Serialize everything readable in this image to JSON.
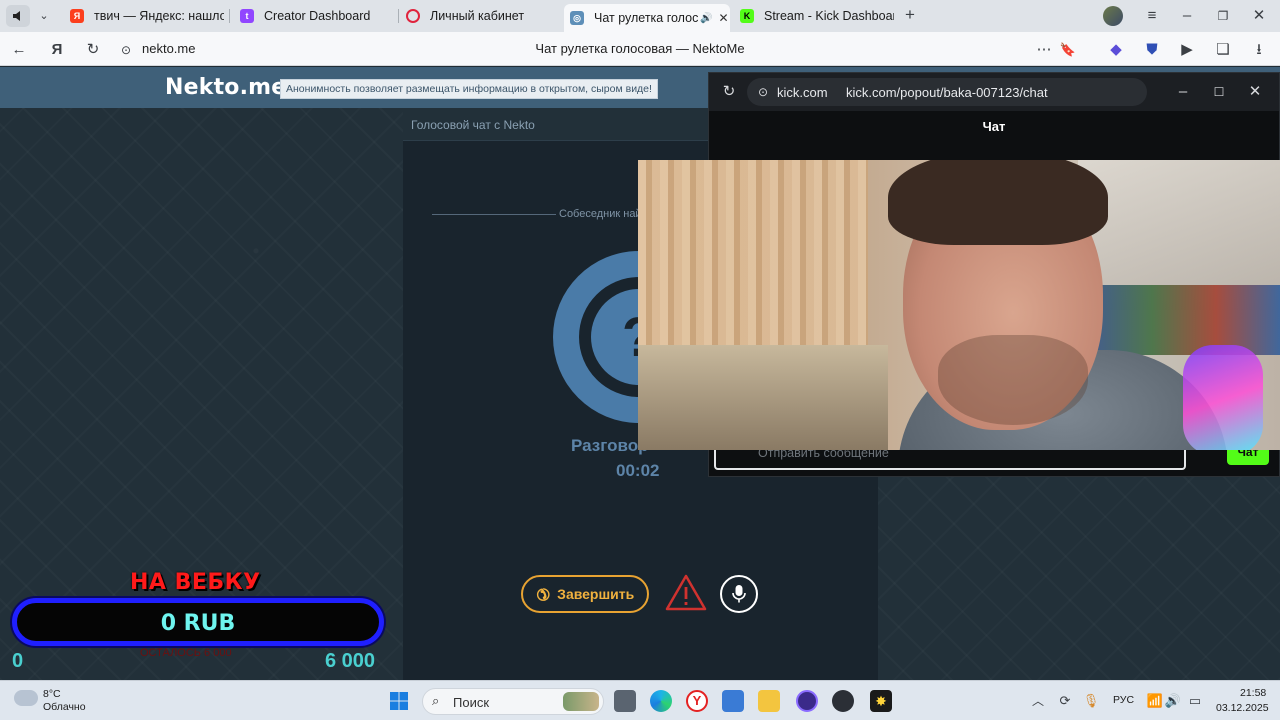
{
  "browser": {
    "tabs": [
      {
        "label": "твич — Яндекс: нашлось",
        "icon": "yandex-icon"
      },
      {
        "label": "Creator Dashboard",
        "icon": "twitch-icon"
      },
      {
        "label": "Личный кабинет",
        "icon": "circle-icon"
      },
      {
        "label": "Чат рулетка голосов",
        "icon": "nekto-icon",
        "active": true
      },
      {
        "label": "Stream - Kick Dashboard",
        "icon": "kick-icon"
      }
    ],
    "url": "nekto.me",
    "page_title": "Чат рулетка голосовая — NektoMe"
  },
  "site": {
    "logo": "Nekto.me",
    "notice": "Анонимность позволяет размещать информацию в открытом, сыром виде!",
    "voice_title": "Голосовой чат с Nekto",
    "found_text": "Собеседник най",
    "status_text": "Разговор",
    "timer": "00:02",
    "end_button": "Завершить"
  },
  "kick": {
    "domain": "kick.com",
    "path": "kick.com/popout/baka-007123/chat",
    "chat_title": "Чат",
    "input_placeholder": "Отправить сообщение",
    "send_label": "Чат"
  },
  "donation": {
    "title": "НА ВЕБКУ",
    "amount": "0 RUB",
    "min": "0",
    "max": "6 000",
    "subtitle": "ОСТАЛОСЬ 6 000"
  },
  "taskbar": {
    "temperature": "8°C",
    "weather": "Облачно",
    "search": "Поиск",
    "lang": "РУС",
    "time": "21:58",
    "date": "03.12.2025"
  },
  "colors": {
    "accent_orange": "#e8a332",
    "kick_green": "#53fc18",
    "nekto_blue": "#4a7ba8",
    "donation_red": "#ff1a1a",
    "donation_border": "#1f1fff"
  }
}
